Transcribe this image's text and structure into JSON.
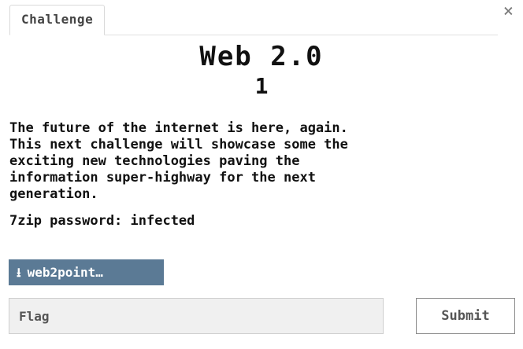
{
  "modal": {
    "tab_label": "Challenge",
    "close_glyph": "×",
    "close_icon": "close-icon"
  },
  "challenge": {
    "title": "Web 2.0",
    "points": "1",
    "description": "The future of the internet is here, again.\nThis next challenge will showcase some the\nexciting new technologies paving the\ninformation super-highway for the next\ngeneration.",
    "password_line": "7zip password: infected"
  },
  "download": {
    "icon": "download-icon",
    "icon_glyph": "⭳",
    "label": "web2point…",
    "color": "#5b7a95"
  },
  "flag_form": {
    "placeholder": "Flag",
    "value": "",
    "submit_label": "Submit"
  }
}
